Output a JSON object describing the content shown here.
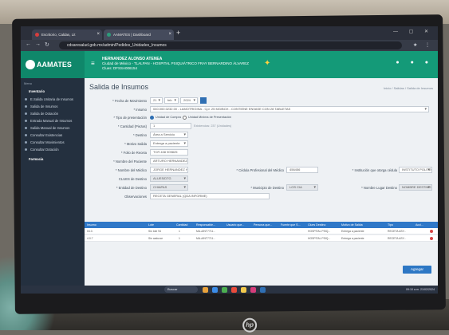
{
  "browser": {
    "tabs": [
      {
        "label": "Escritorio, Caldas, Lit",
        "active": false
      },
      {
        "label": "AAMATES | Dashboard",
        "active": true
      }
    ],
    "new_tab": "+",
    "url": "cdsaresalud.gob.mx/admin/Pedidos_Unidades_Insumos"
  },
  "app": {
    "name": "AAMATES",
    "hospital_title": "HERNANDEZ ALONSO ATENEA",
    "hospital_line1": "Ciudad de México - TLALPAN - HOSPITAL PSIQUIÁTRICO FRAY BERNARDINO ÁLVAREZ",
    "hospital_line2": "Clues: DFSSA006154",
    "accent": "#149a78"
  },
  "sidebar": {
    "menu_label": "Menu",
    "items": [
      {
        "label": "Inventario",
        "top": true
      },
      {
        "label": "E.Salida Unitaria de Insumos"
      },
      {
        "label": "Salida de Insumos"
      },
      {
        "label": "Salida de Dotación"
      },
      {
        "label": "Entrada Manual de Insumos"
      },
      {
        "label": "Salida Manual de Insumos"
      },
      {
        "label": "Consultar Existencias"
      },
      {
        "label": "Consultar Movimientos"
      },
      {
        "label": "Consultar Dotación"
      },
      {
        "label": "Farmacia",
        "top": true
      }
    ]
  },
  "page": {
    "title": "Salida de Insumos",
    "breadcrumb": "Inicio / Salidas / Salida de Insumos"
  },
  "form": {
    "fecha_label": "* Fecha de Movimiento",
    "fecha_day": "21",
    "fecha_month": "feb",
    "fecha_year": "2024",
    "insumo_label": "* Insumo",
    "insumo_value": "040.000.0232.00 - LAMOTRIGINA - Cpr. 25 MG/BOX - CONTIENE ENVASE CON 28 TABLETAS",
    "tipo_label": "* Tipo de presentación",
    "tipo_opt1": "Unidad de Compra",
    "tipo_opt2": "Unidad Mínima de Presentación",
    "cantidad_label": "* Cantidad (Piezas)",
    "cantidad_value": "1",
    "cantidad_hint": "Existencias: 237 (Unidades)",
    "destino_label": "* Destino",
    "destino_value": "Área a Servicio",
    "motivo_label": "* Motivo Salida",
    "motivo_value": "Entrega a paciente",
    "folio_label": "* Folio de Receta",
    "folio_value": "TCR 438 909825",
    "paciente_label": "* Nombre del Paciente",
    "paciente_value": "ARTURO HERNANDEZ MAYA",
    "medico_label": "* Nombre del Médico",
    "medico_value": "JORGE HERNANDEZ HERN",
    "cedula_label": "* Cédula Profesional del Médico",
    "cedula_value": "456456",
    "inst_label": "* Institución que otorga cédula",
    "inst_value": "INSTITUTO POLITÉCNICO",
    "clues_label": "CLUES de Destino",
    "clues_value": "ALUES/DTG",
    "entidad_label": "* Entidad de Destino",
    "entidad_value": "CHIAPAS",
    "municipio_label": "* Municipio de Destino",
    "municipio_value": "LOS CIA",
    "lugar_label": "* Nombre Lugar Destino",
    "lugar_value": "NOMBRE DESTINO",
    "obs_label": "Observaciones",
    "obs_value": "RECETA GENERAL (QDA INFORME)",
    "agregar_label": "Agregar"
  },
  "table": {
    "headers": [
      "Insumo",
      "Lote",
      "Cantidad",
      "Responsable...",
      "Usuario que...",
      "Persona que...",
      "Fuente que S...",
      "Clues Destino",
      "Motivo de Salida",
      "Tipo",
      "Acci..."
    ],
    "rows": [
      [
        "04.0.",
        "Sin lote 94",
        "1",
        "MA-A/NT7711...",
        "",
        "",
        "",
        "HOSPITAL PSIQ...",
        "Entrega a paciente",
        "RECETA ASY..."
      ],
      [
        "4.0.7",
        "Sin caducar",
        "1",
        "MA-A/NT7711...",
        "",
        "",
        "",
        "HOSPITAL PSIQ...",
        "Entrega a paciente",
        "RECETA ASY..."
      ]
    ]
  },
  "taskbar": {
    "search": "Buscar",
    "time": "09:10 a.m.",
    "date": "21/02/2024"
  }
}
